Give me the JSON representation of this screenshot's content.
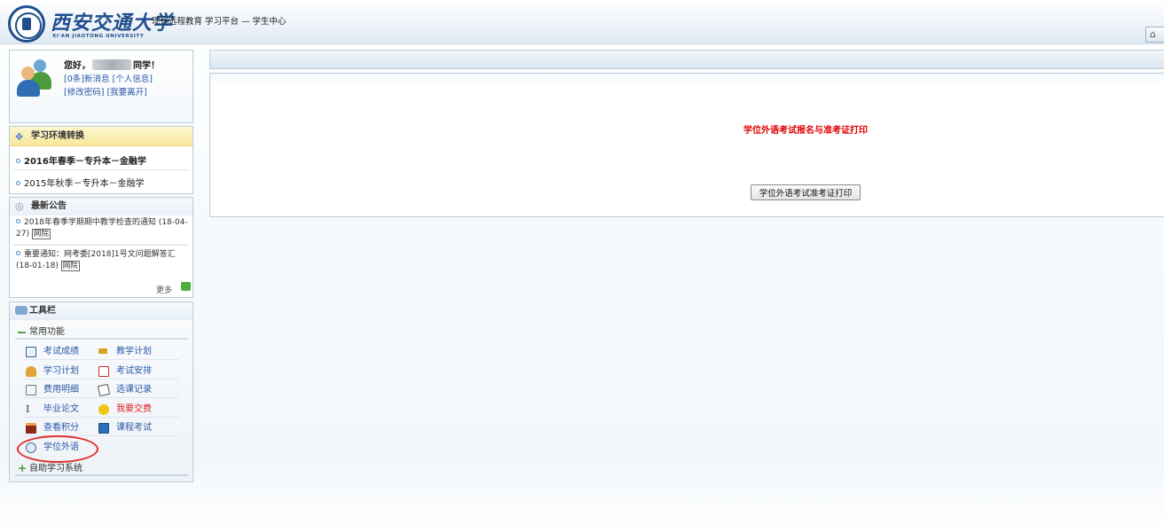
{
  "header": {
    "logo_cn": "西安交通大学",
    "logo_en": "XI'AN JIAOTONG UNIVERSITY",
    "title": "现代远程教育 学习平台 — 学生中心",
    "home_icon": "home-icon"
  },
  "user": {
    "greeting_prefix": "您好，",
    "greeting_suffix": "同学！",
    "messages_link": "[0条]新消息",
    "profile_link": "[个人信息]",
    "password_link": "[修改密码]",
    "logout_link": "[我要离开]"
  },
  "env": {
    "title": "学习环境转换",
    "items": [
      "2016年春季－专升本－金融学",
      "2015年秋季－专升本－金融学"
    ]
  },
  "notices": {
    "title": "最新公告",
    "items": [
      {
        "text": "2018年春季学期期中教学检查的通知 (18-04-27)",
        "tag": "网院"
      },
      {
        "text": "重要通知：网考委[2018]1号文问题解答汇 (18-01-18)",
        "tag": "网院"
      }
    ],
    "more": "更多"
  },
  "toolbar": {
    "title": "工具栏",
    "common_section": "常用功能",
    "self_study_section": "自助学习系统",
    "tools": [
      {
        "label": "考试成绩",
        "icon": "grades-icon"
      },
      {
        "label": "教学计划",
        "icon": "teaching-plan-icon"
      },
      {
        "label": "学习计划",
        "icon": "study-plan-icon"
      },
      {
        "label": "考试安排",
        "icon": "exam-schedule-icon"
      },
      {
        "label": "费用明细",
        "icon": "fee-detail-icon"
      },
      {
        "label": "选课记录",
        "icon": "course-record-icon"
      },
      {
        "label": "毕业论文",
        "icon": "thesis-icon"
      },
      {
        "label": "我要交费",
        "icon": "pay-fee-icon"
      },
      {
        "label": "查看积分",
        "icon": "points-icon"
      },
      {
        "label": "课程考试",
        "icon": "course-exam-icon"
      },
      {
        "label": "学位外语",
        "icon": "degree-language-icon"
      }
    ]
  },
  "main": {
    "title": "学位外语考试报名与准考证打印",
    "print_button": "学位外语考试准考证打印"
  },
  "colors": {
    "accent_blue": "#1f4e8c",
    "link_blue": "#2a58a8",
    "alert_red": "#e00000",
    "highlight_circle": "#e03232"
  }
}
